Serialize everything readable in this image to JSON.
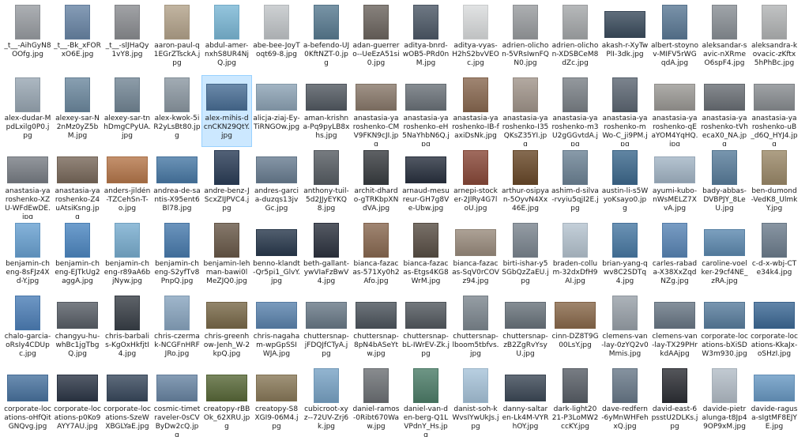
{
  "files": [
    {
      "name": "_t__-AihGyN8OOfg.jpg",
      "c": "#9a9ea3",
      "o": "p"
    },
    {
      "name": "_t__-Bk_xFORxO6E.jpg",
      "c": "#6a86a6",
      "o": "p"
    },
    {
      "name": "_t__-slJHaQy1vY8.jpg",
      "c": "#8c8e92",
      "o": "p"
    },
    {
      "name": "aaron-paul-q1EGrZTsckA.jpg",
      "c": "#b4a48c",
      "o": "p"
    },
    {
      "name": "abdul-amer-nxhS8UR4NjQ.jpg",
      "c": "#7cb8d6",
      "o": "p"
    },
    {
      "name": "abe-bee-JoyToqt69-8.jpg",
      "c": "#c2c6c9",
      "o": "p"
    },
    {
      "name": "a-befendo-UJ0KftNZT-0.jpg",
      "c": "#5a7c92",
      "o": "p"
    },
    {
      "name": "adan-guerrero--UeEzA51si0.jpg",
      "c": "#6d6660",
      "o": "p"
    },
    {
      "name": "aditya-bnrd-wOB5-PRd0nM.jpg",
      "c": "#4e5a68",
      "o": "p"
    },
    {
      "name": "aditya-vyas-H2hS2bvVEOc.jpg",
      "c": "#dadcdd",
      "o": "p"
    },
    {
      "name": "adrien-olichon-5VRsIwnFQN0.jpg",
      "c": "#9a9da0",
      "o": "p"
    },
    {
      "name": "adrien-olichon-XDSBCeM8dZc.jpg",
      "c": "#a6a9ab",
      "o": "p"
    },
    {
      "name": "akash-r-XyTwPlI-3dk.jpg",
      "c": "#3c4d5e",
      "o": "l"
    },
    {
      "name": "albert-stoynov-MIFV5rWGqdA.jpg",
      "c": "#5c7a96",
      "o": "p"
    },
    {
      "name": "aleksandar-savic-nXRmeO6spF4.jpg",
      "c": "#8a9096",
      "o": "p"
    },
    {
      "name": "aleksandra-kovacic-zKftx5hPhBc.jpg",
      "c": "#b3b5b6",
      "o": "p"
    },
    {
      "name": "alex-dudar-MpdLxilg0P0.jpg",
      "c": "#9aa8b4",
      "o": "p"
    },
    {
      "name": "alexey-sar-N2nMz0yZ5bM.jpg",
      "c": "#6e8aa0",
      "o": "p"
    },
    {
      "name": "alexey-sar-tnhDmgCPyUA.jpg",
      "c": "#748796",
      "o": "p"
    },
    {
      "name": "alex-kwok-5iR2yLsBt80.jpg",
      "c": "#8d99a3",
      "o": "p"
    },
    {
      "name": "alex-mihis-dcnCKN29QtY.jpg",
      "c": "#4a6f96",
      "o": "l",
      "sel": true
    },
    {
      "name": "alicja-ziaj-Ey-TiRNGOw.jpg",
      "c": "#8ea4b6",
      "o": "l"
    },
    {
      "name": "aman-krishna-Pq9pyLB8xhs.jpg",
      "c": "#545b63",
      "o": "l"
    },
    {
      "name": "anastasia-yaroshenko-CMV9FKN9cJI.jpg",
      "c": "#8a7a6c",
      "o": "l"
    },
    {
      "name": "anastasia-yaroshenko-eH5NaYhbN6Q.jpg",
      "c": "#6c737a",
      "o": "l"
    },
    {
      "name": "anastasia-yaroshenko-IB-faxiDsNk.jpg",
      "c": "#8a6a52",
      "o": "p"
    },
    {
      "name": "anastasia-yaroshenko-I35QKsZ35YI.jpg",
      "c": "#a2968c",
      "o": "p"
    },
    {
      "name": "anastasia-yaroshenko-m3U2gGGvtdA.jpg",
      "c": "#7c8288",
      "o": "p"
    },
    {
      "name": "anastasia-yaroshenko-mWo-C_ji9PM.jpg",
      "c": "#5e6874",
      "o": "p"
    },
    {
      "name": "anastasia-yaroshenko-qEaYOM4YqHQ.jpg",
      "c": "#9c9a96",
      "o": "l"
    },
    {
      "name": "anastasia-yaroshenko-tVhecaX0_NA.jpg",
      "c": "#6b7076",
      "o": "l"
    },
    {
      "name": "anastasia-yaroshenko-uB_d6Q_HYJ4.jpg",
      "c": "#8a8e92",
      "o": "l"
    },
    {
      "name": "anastasia-yaroshenko-XZU-WFdEwDE.jpg",
      "c": "#7a7f86",
      "o": "l"
    },
    {
      "name": "anastasia-yaroshenko-Z4uAtsiKsng.jpg",
      "c": "#7a6a5c",
      "o": "l"
    },
    {
      "name": "anders-jildén-TZCehSn-T-o.jpg",
      "c": "#b6784c",
      "o": "l"
    },
    {
      "name": "andrea-de-santis-X95ent6Bl78.jpg",
      "c": "#4a7aa6",
      "o": "l"
    },
    {
      "name": "andre-benz-JScxZIJPVC4.jpg",
      "c": "#2c3e58",
      "o": "p"
    },
    {
      "name": "andres-garcia-duzqs13jvGc.jpg",
      "c": "#6a7e92",
      "o": "l"
    },
    {
      "name": "anthony-tuil-5d2JJyEYKQ8.jpg",
      "c": "#585e64",
      "o": "p"
    },
    {
      "name": "archit-dhardo-gTRKbpXNdVA.jpg",
      "c": "#3a3e42",
      "o": "p"
    },
    {
      "name": "arnaud-mesureur-GH7g8Ve-Ubw.jpg",
      "c": "#2a3240",
      "o": "l"
    },
    {
      "name": "arnepi-stocker-2JlRy4G7loU.jpg",
      "c": "#8a4a3a",
      "o": "p"
    },
    {
      "name": "arthur-osipyan-5OyvN4Xx46E.jpg",
      "c": "#6a4a2a",
      "o": "p"
    },
    {
      "name": "ashim-d-silva-rvyiu5qjI2E.jpg",
      "c": "#6e8496",
      "o": "p"
    },
    {
      "name": "austin-li-s5WyoKsayo0.jpg",
      "c": "#3e6a8e",
      "o": "p"
    },
    {
      "name": "ayumi-kubo-nWsMELZ7XvA.jpg",
      "c": "#a4b6c6",
      "o": "l"
    },
    {
      "name": "bady-abbas-DVBPJY_8LeU.jpg",
      "c": "#5a7e9c",
      "o": "p"
    },
    {
      "name": "ben-dumond-VedK8_UlmkY.jpg",
      "c": "#9c8a6a",
      "o": "p"
    },
    {
      "name": "benjamin-cheng-8sFJz4Xd-Y.jpg",
      "c": "#6aa2d2",
      "o": "p"
    },
    {
      "name": "benjamin-cheng-EJTkUg2aggA.jpg",
      "c": "#4e88c2",
      "o": "p"
    },
    {
      "name": "benjamin-cheng-r89aA6bjNyw.jpg",
      "c": "#7aaed0",
      "o": "p"
    },
    {
      "name": "benjamin-cheng-S2yfTv8PnpQ.jpg",
      "c": "#4a7cae",
      "o": "p"
    },
    {
      "name": "benjamin-lehman-bawi0lMeZJQ0.jpg",
      "c": "#6a5a4a",
      "o": "p"
    },
    {
      "name": "benno-klandt-Qr5pi1_GlvY.jpg",
      "c": "#2a3a4e",
      "o": "l"
    },
    {
      "name": "beth-gallant-ywVIaFzBwV4.jpg",
      "c": "#2e3440",
      "o": "p"
    },
    {
      "name": "bianca-fazacas-571Xy0h2Afo.jpg",
      "c": "#8a6a52",
      "o": "p"
    },
    {
      "name": "bianca-fazacas-Etgs4KG8WrM.jpg",
      "c": "#5a5046",
      "o": "p"
    },
    {
      "name": "bianca-fazacas-SqV0rCOVz94.jpg",
      "c": "#9a8c7e",
      "o": "l"
    },
    {
      "name": "birti-ishar-y5SGbQzZaEU.jpg",
      "c": "#7c8690",
      "o": "p"
    },
    {
      "name": "braden-collum-32dxDfH9AI.jpg",
      "c": "#b6c4d0",
      "o": "p"
    },
    {
      "name": "brian-yang-qwv8C2SDTq4.jpg",
      "c": "#4a7aa4",
      "o": "p"
    },
    {
      "name": "carles-rabada-X38XxZqdNZg.jpg",
      "c": "#5a86b6",
      "o": "p"
    },
    {
      "name": "caroline-voelker-29cf4NE_zRA.jpg",
      "c": "#5e8ab0",
      "o": "l"
    },
    {
      "name": "c-d-x-wbj-CTe34k4.jpg",
      "c": "#6e7e8e",
      "o": "p"
    },
    {
      "name": "chalo-garcia-oRsIy4CDUpc.jpg",
      "c": "#4e80b8",
      "o": "p"
    },
    {
      "name": "changyu-hu-whBc1jgTbgQ.jpg",
      "c": "#5a6068",
      "o": "l"
    },
    {
      "name": "chris-barbalis-KgOxHkfjtI4.jpg",
      "c": "#3a4048",
      "o": "p"
    },
    {
      "name": "chris-czermak-NCGFnHRFJRo.jpg",
      "c": "#8aa6c0",
      "o": "p"
    },
    {
      "name": "chris-greenhow-Jenh_W-2kpQ.jpg",
      "c": "#7a6a4a",
      "o": "l"
    },
    {
      "name": "chris-nagaham-wpGpSSIWJA.jpg",
      "c": "#5c84ae",
      "o": "l"
    },
    {
      "name": "chuttersnap-jFDQJfCTyA.jpg",
      "c": "#6a7a88",
      "o": "l"
    },
    {
      "name": "chuttersnap-8pN4bASeYtw.jpg",
      "c": "#4e565e",
      "o": "l"
    },
    {
      "name": "chuttersnap-bL-IWrEV-Zk.jpg",
      "c": "#545a60",
      "o": "l"
    },
    {
      "name": "chuttersnap-lboom5tbfvs.jpg",
      "c": "#7e8890",
      "o": "p"
    },
    {
      "name": "chuttersnap-zB2ZgRvYsyU.jpg",
      "c": "#6a747c",
      "o": "l"
    },
    {
      "name": "cinn-DZ8T9G00LsY.jpg",
      "c": "#8a6a4c",
      "o": "l"
    },
    {
      "name": "clemens-van-lay-0zYQ2v0Mmis.jpg",
      "c": "#9aa2aa",
      "o": "p"
    },
    {
      "name": "clemens-van-lay-TX29PHrkdAAjpg",
      "c": "#6a7886",
      "o": "l"
    },
    {
      "name": "corporate-locations-bXiSDW3m930.jpg",
      "c": "#5a7e9e",
      "o": "l"
    },
    {
      "name": "corporate-locations-KkaJx-oSHzI.jpg",
      "c": "#3e6a96",
      "o": "l"
    },
    {
      "name": "corporate-locations-oHfQitGNQvg.jpg",
      "c": "#4a74a0",
      "o": "l"
    },
    {
      "name": "corporate-locations-p0Ko9AYY7AU.jpg",
      "c": "#2e3848",
      "o": "l"
    },
    {
      "name": "corporate-locations-SzeWXBGLYaE.jpg",
      "c": "#3a4a5e",
      "o": "l"
    },
    {
      "name": "cosmic-timetraveler-0sCVByDw2cQ.jpg",
      "c": "#6a86a4",
      "o": "l"
    },
    {
      "name": "creatopy-rBBOk_62XRU.jpg",
      "c": "#5a6a3a",
      "o": "l"
    },
    {
      "name": "creatopy-S8XGI9-06M4.jpg",
      "c": "#8a7a5a",
      "o": "l"
    },
    {
      "name": "cubicroot-xyz--72UV-Zrj6k.jpg",
      "c": "#7aa4c6",
      "o": "p"
    },
    {
      "name": "daniel-ramos-0Ribt670Waw.jpg",
      "c": "#6e7276",
      "o": "p"
    },
    {
      "name": "daniel-van-den-berg-Q1LVPdnY_Hs.jpg",
      "c": "#4e7e6a",
      "o": "p"
    },
    {
      "name": "danist-soh-kWvsIYwUkJs.jpg",
      "c": "#a8c4da",
      "o": "p"
    },
    {
      "name": "danny-saltaren-Lk4M-VYRhOY.jpg",
      "c": "#3e4a58",
      "o": "l"
    },
    {
      "name": "dark-light2021-P3LoMW2ccKY.jpg",
      "c": "#5a6068",
      "o": "p"
    },
    {
      "name": "dave-redfern-6yMnWHFehxQ.jpg",
      "c": "#6a7a8a",
      "o": "p"
    },
    {
      "name": "david-east-6psstU2DLKs.jpg",
      "c": "#2e3036",
      "o": "p"
    },
    {
      "name": "davide-pietralunga-t8Jp49OP9xM.jpg",
      "c": "#b4bec8",
      "o": "p"
    },
    {
      "name": "davide-ragusa-sIgtMF8EJYE.jpg",
      "c": "#6a9ac4",
      "o": "l"
    }
  ]
}
